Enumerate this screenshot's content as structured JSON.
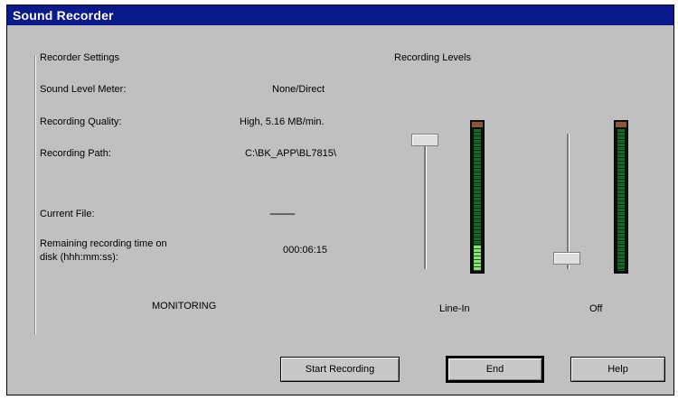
{
  "window": {
    "title": "Sound Recorder"
  },
  "settings": {
    "header": "Recorder Settings",
    "rows": [
      {
        "label": "Sound Level Meter:",
        "value": "None/Direct"
      },
      {
        "label": "Recording Quality:",
        "value": "High, 5.16 MB/min."
      },
      {
        "label": "Recording Path:",
        "value": "C:\\BK_APP\\BL7815\\"
      }
    ],
    "current_file": {
      "label": "Current File:",
      "value": "----------------"
    },
    "remaining": {
      "label_line1": "Remaining recording time on",
      "label_line2": "disk (hhh:mm:ss):",
      "value": "000:06:15"
    },
    "status": "MONITORING"
  },
  "levels": {
    "header": "Recording Levels",
    "channels": [
      {
        "label": "Line-In",
        "slider_level": 0.95,
        "meter_level": 0.18
      },
      {
        "label": "Off",
        "slider_level": 0.05,
        "meter_level": 0.0
      }
    ]
  },
  "buttons": {
    "start": "Start Recording",
    "end": "End",
    "help": "Help"
  }
}
